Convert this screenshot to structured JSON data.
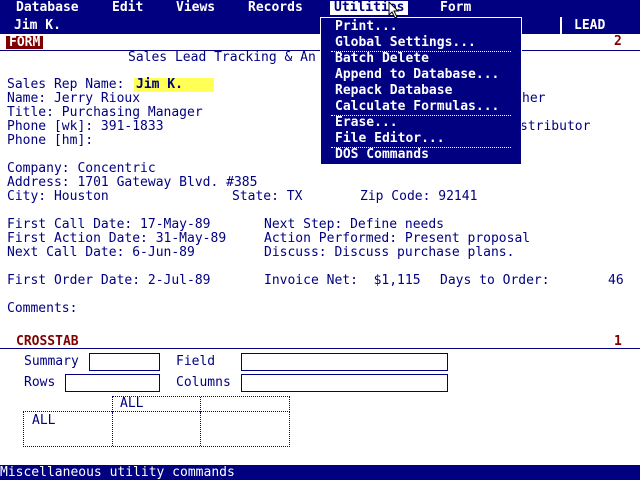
{
  "menu": {
    "items": [
      "Database",
      "Edit",
      "Views",
      "Records",
      "Utilities",
      "Form"
    ],
    "active": "Utilities"
  },
  "user_bar": {
    "user": "Jim K.",
    "view": "LEAD"
  },
  "form_panel": {
    "tag": "FORM",
    "number": "2"
  },
  "form": {
    "title": "Sales Lead Tracking & An",
    "sales_rep_label": "Sales Rep Name:",
    "sales_rep_value": "Jim K.",
    "name": "Name: Jerry Rioux",
    "title_line": "Title: Purchasing Manager",
    "phone_wk": "Phone [wk]: 391-1833",
    "phone_hm": "Phone [hm]:",
    "right_fragment_1": "her",
    "right_fragment_2": "stributor",
    "company": "Company: Concentric",
    "address": "Address: 1701 Gateway Blvd. #385",
    "city": "City: Houston",
    "state": "State: TX",
    "zip": "Zip Code: 92141",
    "first_call": "First Call Date: 17-May-89",
    "first_action": "First Action Date: 31-May-89",
    "next_call": "Next Call Date: 6-Jun-89",
    "next_step": "Next Step: Define needs",
    "action_performed": "Action Performed: Present proposal",
    "discuss": "Discuss: Discuss purchase plans.",
    "first_order": "First Order Date: 2-Jul-89",
    "invoice_net": "Invoice Net:  $1,115",
    "days_to_order_label": "Days to Order:",
    "days_to_order_value": "46",
    "comments": "Comments:"
  },
  "dropdown": {
    "items": [
      "Print...",
      "Global Settings...",
      "Batch Delete",
      "Append to Database...",
      "Repack Database",
      "Calculate Formulas...",
      "Erase...",
      "File Editor...",
      "DOS Commands"
    ]
  },
  "crosstab": {
    "tag": "CROSSTAB",
    "number": "1",
    "summary_label": "Summary",
    "field_label": "Field",
    "rows_label": "Rows",
    "columns_label": "Columns",
    "col_header": "ALL",
    "row_header": "ALL"
  },
  "status": {
    "text": "Miscellaneous utility commands"
  }
}
